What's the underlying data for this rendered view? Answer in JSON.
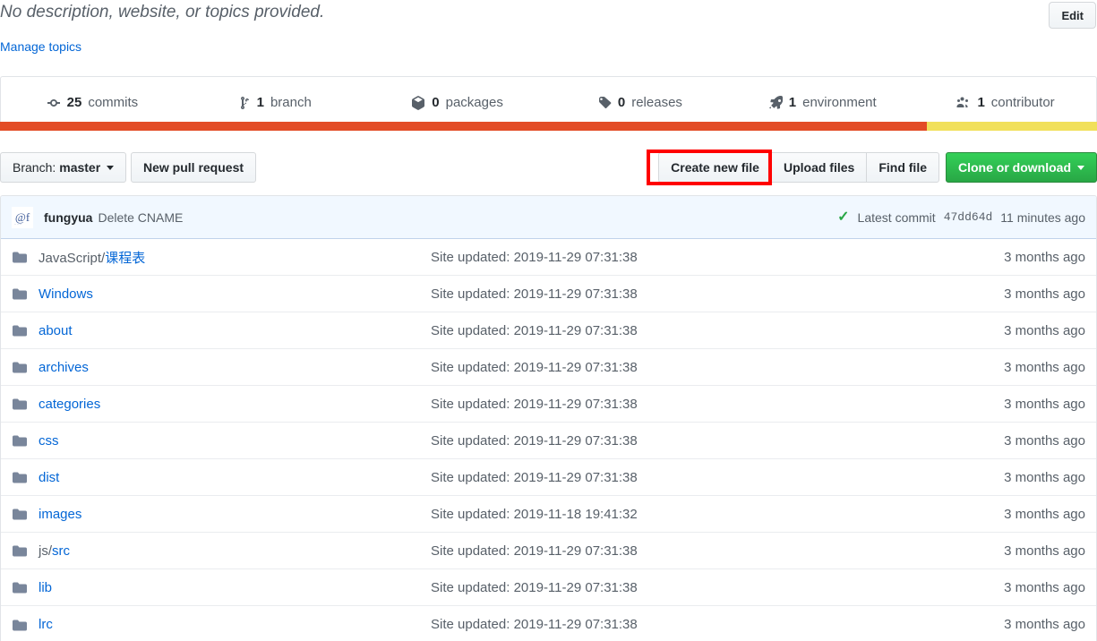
{
  "description": {
    "text": "No description, website, or topics provided.",
    "manage_topics_label": "Manage topics",
    "edit_label": "Edit"
  },
  "stats": [
    {
      "icon": "commit-icon",
      "count": "25",
      "label": "commits"
    },
    {
      "icon": "branch-icon",
      "count": "1",
      "label": "branch"
    },
    {
      "icon": "package-icon",
      "count": "0",
      "label": "packages"
    },
    {
      "icon": "tag-icon",
      "count": "0",
      "label": "releases"
    },
    {
      "icon": "rocket-icon",
      "count": "1",
      "label": "environment"
    },
    {
      "icon": "people-icon",
      "count": "1",
      "label": "contributor"
    }
  ],
  "language_bar": [
    {
      "name": "JavaScript",
      "color": "#e34c26",
      "percent": 84.5
    },
    {
      "name": "CSS",
      "color": "#f1e05a",
      "percent": 15.5
    }
  ],
  "toolbar": {
    "branch_prefix": "Branch:",
    "branch_value": "master",
    "new_pull_request": "New pull request",
    "create_new_file": "Create new file",
    "upload_files": "Upload files",
    "find_file": "Find file",
    "clone_or_download": "Clone or download",
    "highlight_color": "#ff0000"
  },
  "commit": {
    "avatar_text": "@f",
    "author": "fungyua",
    "message": "Delete CNAME",
    "status_icon": "check-icon",
    "latest_label": "Latest commit",
    "sha": "47dd64d",
    "time": "11 minutes ago"
  },
  "files": {
    "rows": [
      {
        "icon": "folder-icon",
        "prefix": "JavaScript/",
        "name": "课程表",
        "message": "Site updated: 2019-11-29 07:31:38",
        "age": "3 months ago"
      },
      {
        "icon": "folder-icon",
        "prefix": "",
        "name": "Windows",
        "message": "Site updated: 2019-11-29 07:31:38",
        "age": "3 months ago"
      },
      {
        "icon": "folder-icon",
        "prefix": "",
        "name": "about",
        "message": "Site updated: 2019-11-29 07:31:38",
        "age": "3 months ago"
      },
      {
        "icon": "folder-icon",
        "prefix": "",
        "name": "archives",
        "message": "Site updated: 2019-11-29 07:31:38",
        "age": "3 months ago"
      },
      {
        "icon": "folder-icon",
        "prefix": "",
        "name": "categories",
        "message": "Site updated: 2019-11-29 07:31:38",
        "age": "3 months ago"
      },
      {
        "icon": "folder-icon",
        "prefix": "",
        "name": "css",
        "message": "Site updated: 2019-11-29 07:31:38",
        "age": "3 months ago"
      },
      {
        "icon": "folder-icon",
        "prefix": "",
        "name": "dist",
        "message": "Site updated: 2019-11-29 07:31:38",
        "age": "3 months ago"
      },
      {
        "icon": "folder-icon",
        "prefix": "",
        "name": "images",
        "message": "Site updated: 2019-11-18 19:41:32",
        "age": "3 months ago"
      },
      {
        "icon": "folder-icon",
        "prefix": "js/",
        "name": "src",
        "message": "Site updated: 2019-11-29 07:31:38",
        "age": "3 months ago"
      },
      {
        "icon": "folder-icon",
        "prefix": "",
        "name": "lib",
        "message": "Site updated: 2019-11-29 07:31:38",
        "age": "3 months ago"
      },
      {
        "icon": "folder-icon",
        "prefix": "",
        "name": "lrc",
        "message": "Site updated: 2019-11-29 07:31:38",
        "age": "3 months ago"
      }
    ]
  }
}
